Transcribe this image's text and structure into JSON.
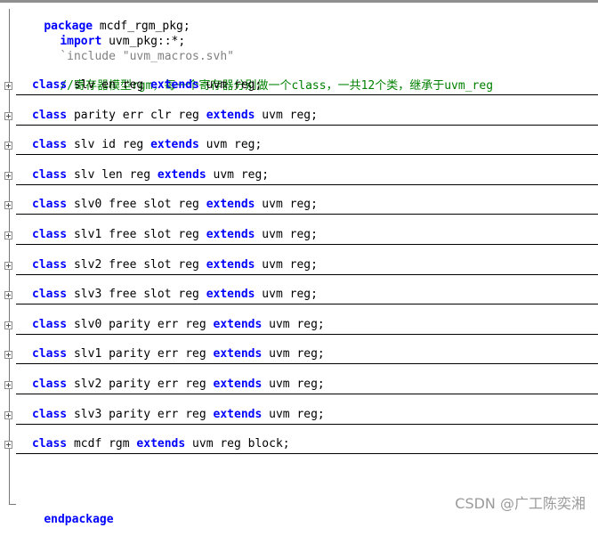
{
  "editor": {
    "package_kw": "package",
    "package_name": " mcdf_rgm_pkg;",
    "import_kw": "import",
    "import_rest": " uvm_pkg::*;",
    "include_directive": "`include",
    "include_file": " \"uvm_macros.svh\"",
    "comment": "//寄存器模型rgm，每一个寄存器分别做一个class，一共12个类，继承于uvm_reg",
    "class_kw": "class",
    "extends_kw": "extends",
    "classes": [
      {
        "name": " slv en reg ",
        "base": " uvm reg;"
      },
      {
        "name": " parity err clr reg ",
        "base": " uvm reg;"
      },
      {
        "name": " slv id reg ",
        "base": " uvm reg;"
      },
      {
        "name": " slv len reg ",
        "base": " uvm reg;"
      },
      {
        "name": " slv0 free slot reg ",
        "base": " uvm reg;"
      },
      {
        "name": " slv1 free slot reg ",
        "base": " uvm reg;"
      },
      {
        "name": " slv2 free slot reg ",
        "base": " uvm reg;"
      },
      {
        "name": " slv3 free slot reg ",
        "base": " uvm reg;"
      },
      {
        "name": " slv0 parity err reg ",
        "base": " uvm reg;"
      },
      {
        "name": " slv1 parity err reg ",
        "base": " uvm reg;"
      },
      {
        "name": " slv2 parity err reg ",
        "base": " uvm reg;"
      },
      {
        "name": " slv3 parity err reg ",
        "base": " uvm reg;"
      },
      {
        "name": " mcdf rgm ",
        "base": " uvm reg block;"
      }
    ],
    "endpackage_kw": "endpackage"
  },
  "watermark": "CSDN @广工陈奕湘",
  "colors": {
    "keyword": "#0000ff",
    "comment": "#008000",
    "string": "#808080",
    "text": "#000000"
  }
}
